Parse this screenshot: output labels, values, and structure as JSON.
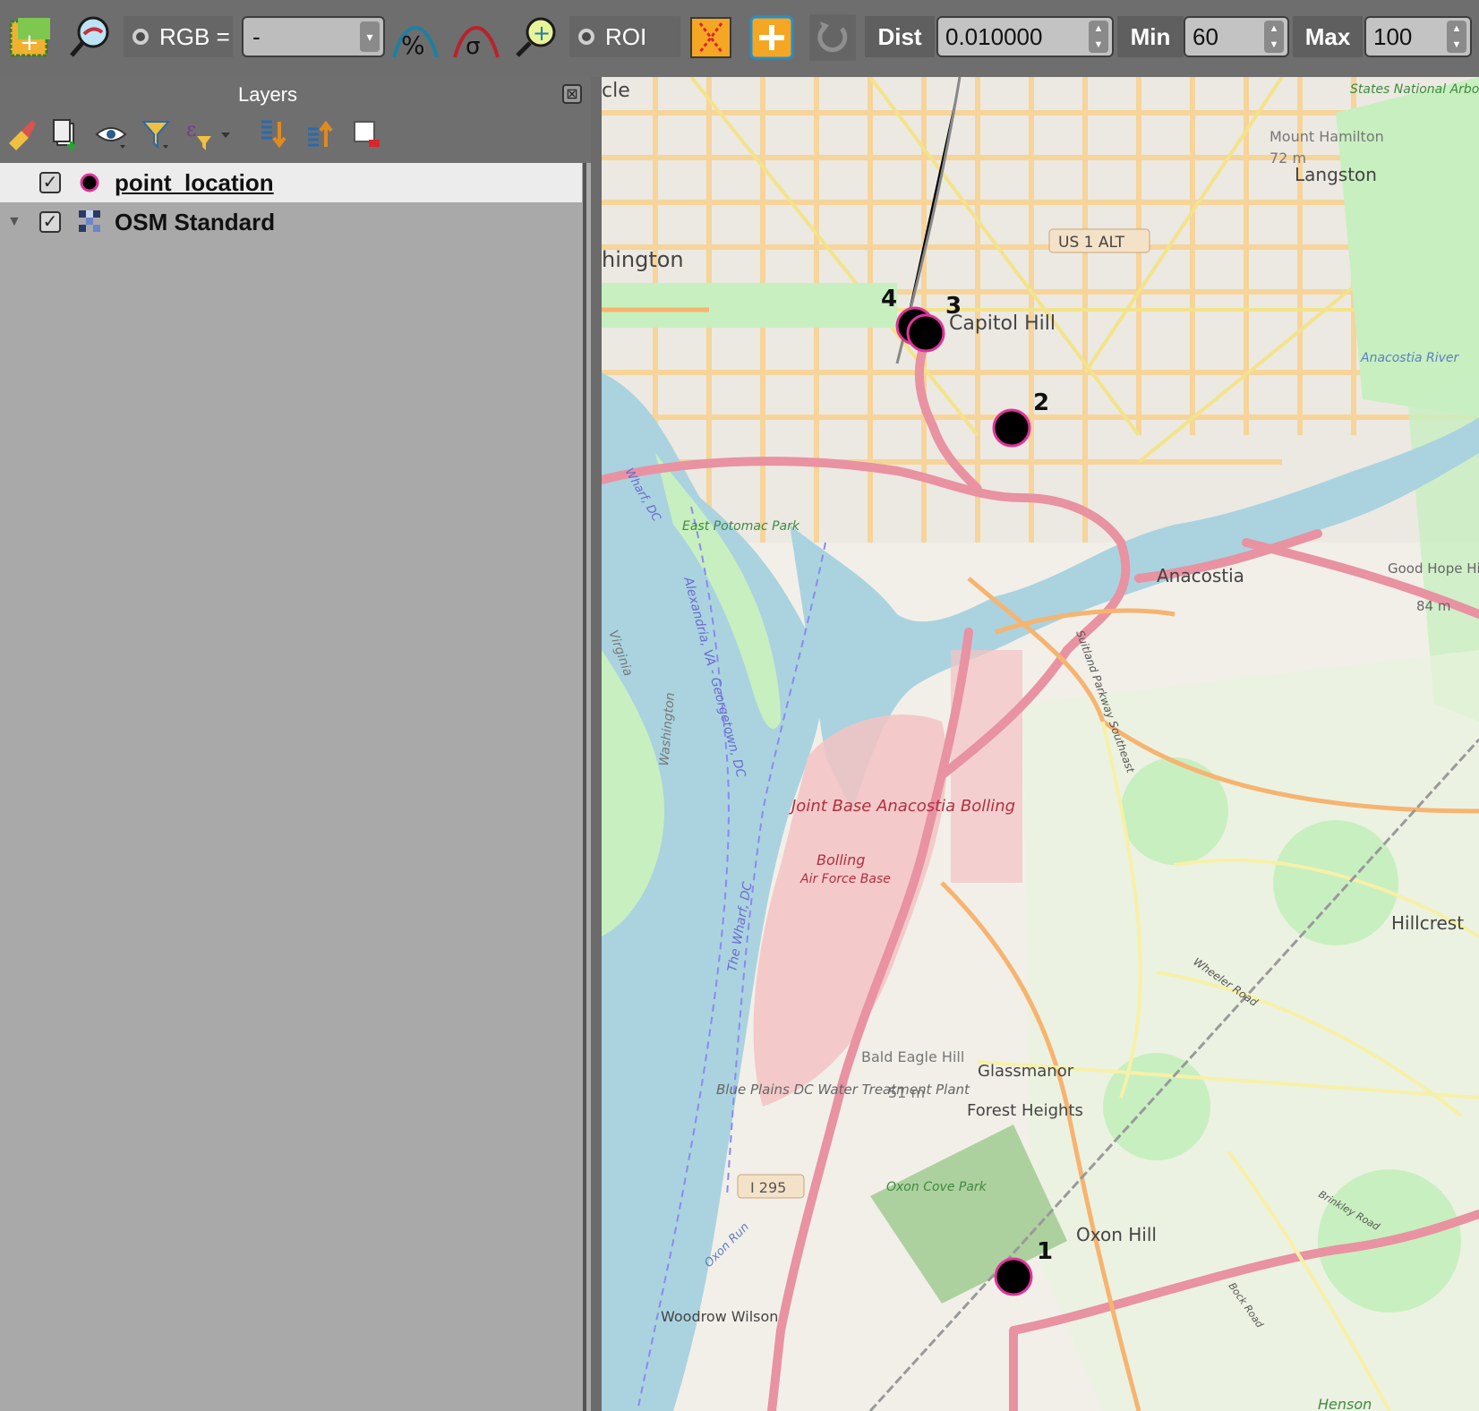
{
  "toolbar": {
    "rgb_label": "RGB =",
    "rgb_value": "-",
    "roi_label": "ROI",
    "dist_label": "Dist",
    "dist_value": "0.010000",
    "min_label": "Min",
    "min_value": "60",
    "max_label": "Max",
    "max_value": "100",
    "icons": [
      "add-layer-icon",
      "map-zoom-icon",
      "percent-curve-icon",
      "sigma-curve-icon",
      "zoom-plus-icon",
      "roi-remove-icon",
      "add-roi-icon",
      "undo-icon"
    ]
  },
  "layers_panel": {
    "title": "Layers",
    "close_glyph": "⊠",
    "layers": [
      {
        "name": "point_location",
        "checked": true,
        "selected": true,
        "symbol": "point"
      },
      {
        "name": "OSM Standard",
        "checked": true,
        "selected": false,
        "symbol": "tile-grid"
      }
    ]
  },
  "map": {
    "place_labels": [
      "cle",
      "hington",
      "Capitol Hill",
      "US 1 ALT",
      "Mount Hamilton",
      "72 m",
      "Langston",
      "States National Arboretum",
      "Anacostia River",
      "East Potomac Park",
      "Anacostia",
      "Good Hope Hill",
      "84 m",
      "Joint Base Anacostia Bolling",
      "Bolling",
      "Air Force Base",
      "Hillcrest",
      "Wheeler Road",
      "Suitland Parkway Southeast",
      "Bald Eagle Hill",
      "51 m",
      "Glassmanor",
      "Forest Heights",
      "Blue Plains DC Water Treatment Plant",
      "I 295",
      "Oxon Cove Park",
      "Oxon Hill",
      "Oxon Run",
      "Woodrow Wilson",
      "Virginia",
      "Washington",
      "Alexandria, VA - Georgetown, DC",
      "The Wharf, DC",
      "Wharf, DC",
      "Brinkley Road",
      "Bock Road",
      "Henson"
    ],
    "point_labels": [
      "1",
      "2",
      "3",
      "4"
    ]
  }
}
